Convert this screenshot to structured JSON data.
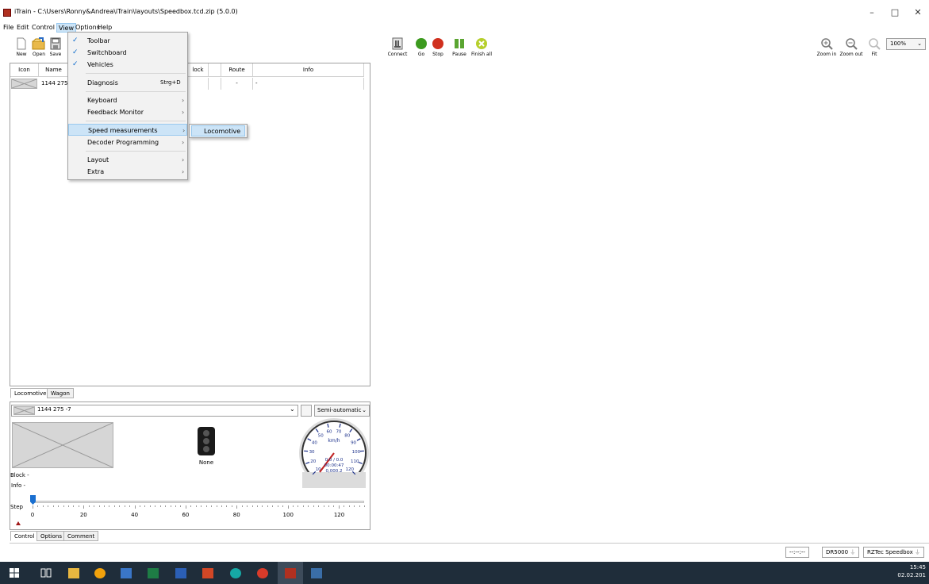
{
  "window": {
    "title": "iTrain - C:\\Users\\Ronny&Andrea\\iTrain\\layouts\\Speedbox.tcd.zip (5.0.0)",
    "minimize": "–",
    "maximize": "□",
    "close": "✕"
  },
  "menubar": [
    "File",
    "Edit",
    "Control",
    "View",
    "Options",
    "Help"
  ],
  "main_toolbar": [
    "New",
    "Open",
    "Save"
  ],
  "control_toolbar": [
    "Connect",
    "Go",
    "Stop",
    "Pause",
    "Finish all"
  ],
  "zoom_toolbar": {
    "zoom_in": "Zoom in",
    "zoom_out": "Zoom out",
    "fit": "Fit",
    "zoom_value": "100%"
  },
  "view_menu": {
    "toolbar": "Toolbar",
    "switchboard": "Switchboard",
    "vehicles": "Vehicles",
    "diagnosis": "Diagnosis",
    "diagnosis_shortcut": "Strg+D",
    "keyboard": "Keyboard",
    "feedback_monitor": "Feedback Monitor",
    "speed_measurements": "Speed measurements",
    "decoder_programming": "Decoder Programming",
    "layout": "Layout",
    "extra": "Extra",
    "arrow": "›",
    "check": "✓"
  },
  "submenu": {
    "locomotive": "Locomotive"
  },
  "vehicle_table": {
    "headers": {
      "icon": "Icon",
      "name": "Name",
      "block": "lock",
      "route": "Route",
      "info": "Info"
    },
    "row": {
      "name": "1144 275 -",
      "route": "-",
      "info": "-"
    }
  },
  "vehicle_tabs": {
    "locomotive": "Locomotive",
    "wagon": "Wagon"
  },
  "control": {
    "selected_loco": "1144 275 -7",
    "mode": "Semi-automatic",
    "signal_label": "None",
    "block_label": "Block",
    "block_value": "-",
    "info_label": "Info",
    "info_value": "-",
    "step_label": "Step",
    "step_ticks": [
      "0",
      "20",
      "40",
      "60",
      "80",
      "100",
      "120"
    ],
    "step_value": 0,
    "step_max": 130,
    "speedo": {
      "unit": "km/h",
      "scale": [
        "10",
        "20",
        "30",
        "40",
        "50",
        "60",
        "70",
        "80",
        "90",
        "100",
        "110",
        "120"
      ],
      "readout1": "0.0 / 0.0",
      "readout2": "00:00:47",
      "readout3": "0,000.2"
    }
  },
  "bottom_tabs": {
    "control": "Control",
    "options": "Options",
    "comment": "Comment"
  },
  "status": {
    "time": "--:--:--",
    "dr": "DR5000",
    "speedbox": "RZTec Speedbox"
  },
  "clock": {
    "time": "15:45",
    "date": "02.02.201"
  },
  "colors": {
    "accent": "#0b6acb",
    "go": "#3c9a1e",
    "stop": "#d0301e",
    "pause": "#5aa531",
    "finish": "#b6cf2c"
  }
}
